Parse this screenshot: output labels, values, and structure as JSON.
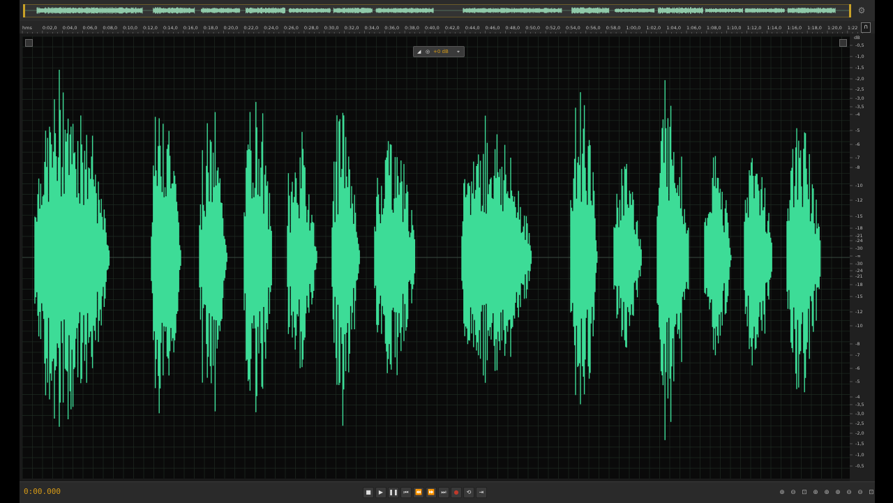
{
  "colors": {
    "waveform": "#3ddc97",
    "background": "#0a0a0a",
    "grid": "#1e2a22",
    "time_display": "#d79b17",
    "overview_marker": "#c9a227"
  },
  "ruler": {
    "labels": [
      "hms",
      "0:02,0",
      "0:04,0",
      "0:06,0",
      "0:08,0",
      "0:10,0",
      "0:12,0",
      "0:14,0",
      "0:16,0",
      "0:18,0",
      "0:20,0",
      "0:22,0",
      "0:24,0",
      "0:26,0",
      "0:28,0",
      "0:30,0",
      "0:32,0",
      "0:34,0",
      "0:36,0",
      "0:38,0",
      "0:40,0",
      "0:42,0",
      "0:44,0",
      "0:46,0",
      "0:48,0",
      "0:50,0",
      "0:52,0",
      "0:54,0",
      "0:56,0",
      "0:58,0",
      "1:00,0",
      "1:02,0",
      "1:04,0",
      "1:06,0",
      "1:08,0",
      "1:10,0",
      "1:12,0",
      "1:14,0",
      "1:16,0",
      "1:18,0",
      "1:20,0",
      "1:22"
    ]
  },
  "db_scale": {
    "header": "dB",
    "labels": [
      "-0,5",
      "-1,0",
      "-1,5",
      "-2,0",
      "-2,5",
      "-3,0",
      "-3,5",
      "-4",
      "-5",
      "-6",
      "-7",
      "-8",
      "-10",
      "-12",
      "-15",
      "-18",
      "-21",
      "-24",
      "-30",
      "-∞",
      "-30",
      "-24",
      "-21",
      "-18",
      "-15",
      "-12",
      "-10",
      "-8",
      "-7",
      "-6",
      "-5",
      "-4",
      "-3,5",
      "-3,0",
      "-2,5",
      "-2,0",
      "-1,5",
      "-1,0",
      "-0,5"
    ]
  },
  "hud": {
    "gain": "+0 dB"
  },
  "transport": {
    "time": "0:00.000",
    "buttons": [
      {
        "name": "stop-button",
        "glyph": "■"
      },
      {
        "name": "play-button",
        "glyph": "▶"
      },
      {
        "name": "pause-button",
        "glyph": "❚❚"
      },
      {
        "name": "move-to-start-button",
        "glyph": "⏮"
      },
      {
        "name": "rewind-button",
        "glyph": "⏪"
      },
      {
        "name": "fast-forward-button",
        "glyph": "⏩"
      },
      {
        "name": "move-to-end-button",
        "glyph": "⏭"
      },
      {
        "name": "record-button",
        "glyph": "●"
      },
      {
        "name": "loop-button",
        "glyph": "⟲"
      },
      {
        "name": "skip-selection-button",
        "glyph": "⇥"
      }
    ],
    "zoom_icons": [
      "zoom-in-amplitude-icon",
      "zoom-out-amplitude-icon",
      "zoom-full-icon",
      "zoom-in-start-icon",
      "zoom-in-end-icon",
      "zoom-in-time-icon",
      "zoom-out-time-icon",
      "zoom-out-full-icon",
      "zoom-selection-icon"
    ]
  }
}
